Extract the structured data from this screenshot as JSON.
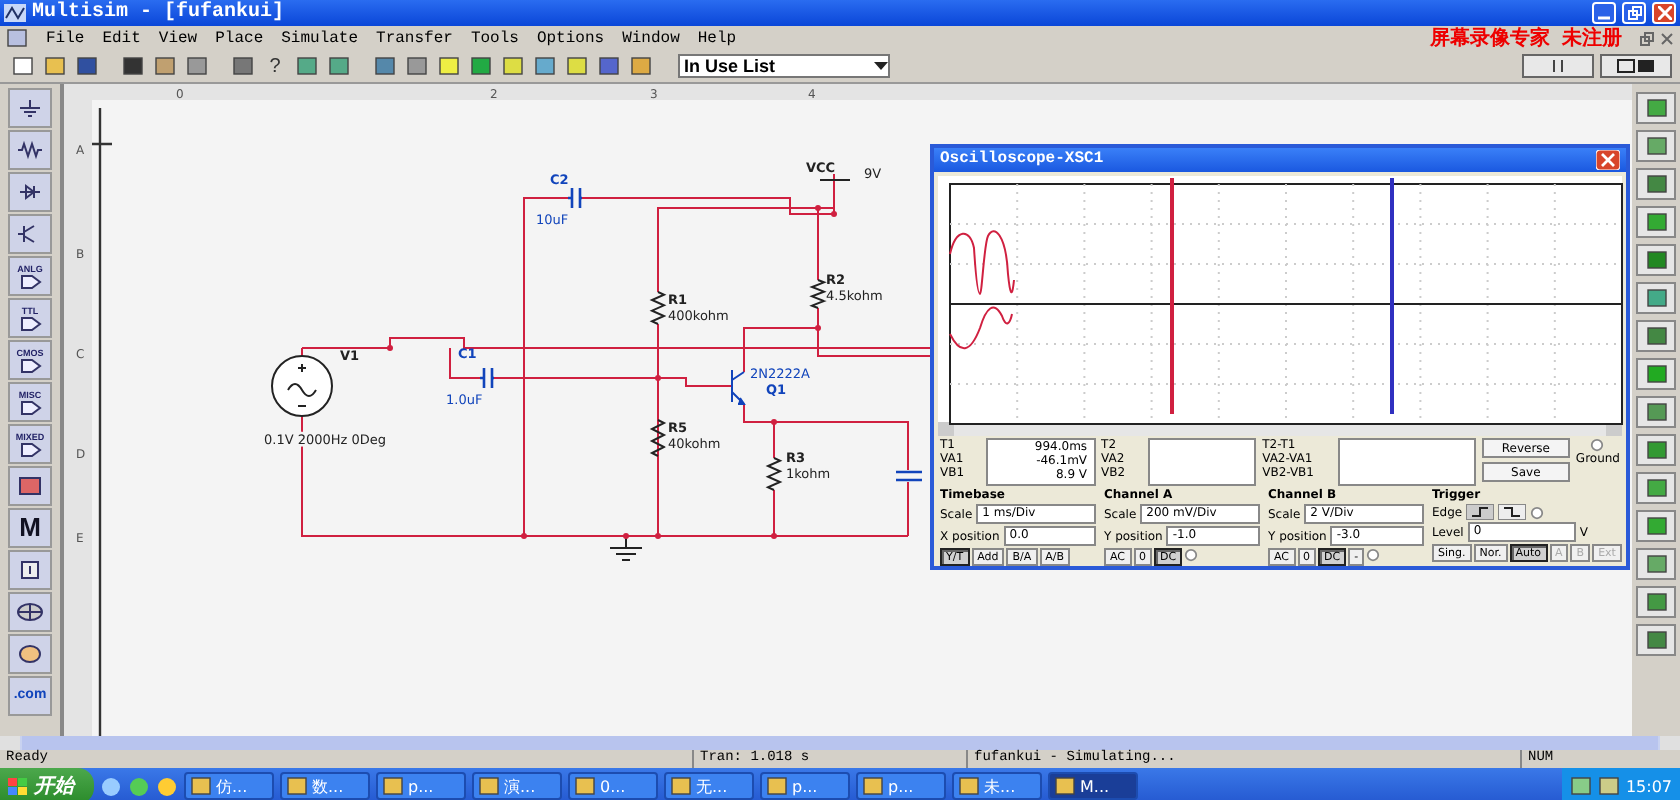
{
  "window": {
    "title": "Multisim - [fufankui]"
  },
  "menu": [
    "File",
    "Edit",
    "View",
    "Place",
    "Simulate",
    "Transfer",
    "Tools",
    "Options",
    "Window",
    "Help"
  ],
  "recorder_notice": "屏幕录像专家  未注册",
  "toolbar": {
    "help_label": "?",
    "dropdown": {
      "value": "In Use List"
    }
  },
  "parts_bin_labels": [
    "ANLG",
    "TTL",
    "CMOS",
    "MISC",
    "MIXED",
    "M",
    ".com"
  ],
  "ruler": {
    "columns": [
      "0",
      "2",
      "3",
      "4"
    ],
    "rows": [
      "A",
      "B",
      "C",
      "D",
      "E"
    ]
  },
  "components": [
    {
      "ref": "C2",
      "value": "10uF"
    },
    {
      "ref": "VCC",
      "value": "9V"
    },
    {
      "ref": "R1",
      "value": "400kohm"
    },
    {
      "ref": "R2",
      "value": "4.5kohm"
    },
    {
      "ref": "V1",
      "value": "0.1V 2000Hz 0Deg"
    },
    {
      "ref": "C1",
      "value": "1.0uF"
    },
    {
      "ref": "Q1",
      "value": "2N2222A"
    },
    {
      "ref": "R5",
      "value": "40kohm"
    },
    {
      "ref": "R3",
      "value": "1kohm"
    }
  ],
  "oscilloscope": {
    "title": "Oscilloscope-XSC1",
    "readouts": [
      {
        "labels": [
          "T1",
          "VA1",
          "VB1"
        ],
        "values": [
          "994.0ms",
          "-46.1mV",
          "8.9 V"
        ]
      },
      {
        "labels": [
          "T2",
          "VA2",
          "VB2"
        ]
      },
      {
        "labels": [
          "T2-T1",
          "VA2-VA1",
          "VB2-VB1"
        ]
      }
    ],
    "buttons": [
      "Reverse",
      "Save"
    ],
    "ground": {
      "label": "Ground",
      "selected": false
    },
    "timebase": {
      "title": "Timebase",
      "fields": [
        {
          "label": "Scale",
          "value": "1 ms/Div"
        },
        {
          "label": "X position",
          "value": "0.0"
        }
      ],
      "modes": [
        {
          "label": "Y/T",
          "selected": true
        },
        {
          "label": "Add",
          "selected": false
        },
        {
          "label": "B/A",
          "selected": false
        },
        {
          "label": "A/B",
          "selected": false
        }
      ]
    },
    "channels": [
      {
        "title": "Channel A",
        "fields": [
          {
            "label": "Scale",
            "value": "200 mV/Div"
          },
          {
            "label": "Y position",
            "value": "-1.0"
          }
        ],
        "coupling": [
          {
            "label": "AC",
            "selected": false
          },
          {
            "label": "0",
            "selected": false
          },
          {
            "label": "DC",
            "selected": true
          }
        ],
        "radio": {
          "selected": false
        }
      },
      {
        "title": "Channel B",
        "fields": [
          {
            "label": "Scale",
            "value": "2 V/Div"
          },
          {
            "label": "Y position",
            "value": "-3.0"
          }
        ],
        "coupling": [
          {
            "label": "AC",
            "selected": false
          },
          {
            "label": "0",
            "selected": false
          },
          {
            "label": "DC",
            "selected": true
          },
          {
            "label": "-",
            "selected": false
          }
        ],
        "radio": {
          "selected": false
        }
      }
    ],
    "trigger": {
      "title": "Trigger",
      "edge_label": "Edge",
      "radio": {
        "selected": false
      },
      "level_label": "Level",
      "level_value": "0",
      "unit": "V",
      "modes": [
        {
          "label": "Sing.",
          "selected": false
        },
        {
          "label": "Nor.",
          "selected": false
        },
        {
          "label": "Auto",
          "selected": true
        }
      ],
      "sources": [
        {
          "label": "A",
          "disabled": true
        },
        {
          "label": "B",
          "disabled": true
        },
        {
          "label": "Ext",
          "disabled": true
        }
      ]
    }
  },
  "status_bar": [
    "Ready",
    "Tran: 1.018 s",
    "fufankui - Simulating...",
    "NUM"
  ],
  "taskbar": {
    "start": "开始",
    "items": [
      {
        "label": "仿...",
        "selected": false
      },
      {
        "label": "数...",
        "selected": false
      },
      {
        "label": "p...",
        "selected": false
      },
      {
        "label": "演...",
        "selected": false
      },
      {
        "label": "0...",
        "selected": false
      },
      {
        "label": "无...",
        "selected": false
      },
      {
        "label": "p...",
        "selected": false
      },
      {
        "label": "p...",
        "selected": false
      },
      {
        "label": "未...",
        "selected": false
      },
      {
        "label": "M...",
        "selected": true
      }
    ],
    "clock": "15:07"
  }
}
